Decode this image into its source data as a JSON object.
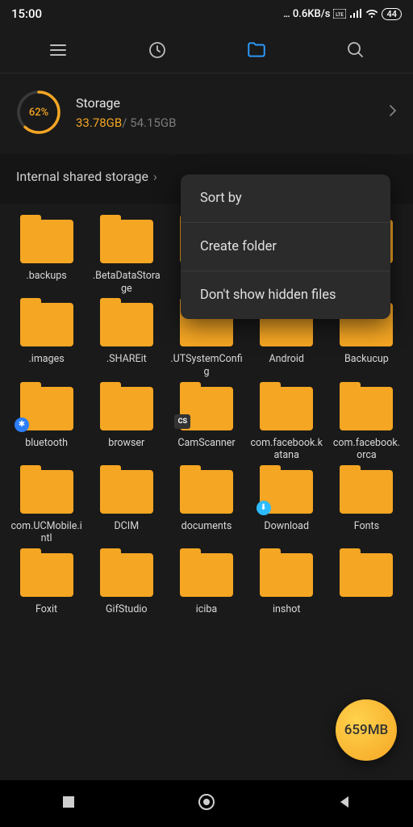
{
  "status": {
    "time": "15:00",
    "net_speed": "0.6KB/s",
    "battery": "44"
  },
  "storage": {
    "title": "Storage",
    "percent": "62%",
    "used": "33.78GB",
    "total": "54.15GB"
  },
  "breadcrumb": {
    "path": "Internal shared storage"
  },
  "popup": {
    "sort": "Sort by",
    "create": "Create folder",
    "hidden": "Don't show hidden files"
  },
  "fab": {
    "label": "659MB"
  },
  "folders": {
    "r1": [
      ".backups",
      ".BetaDataStorage",
      ".",
      "",
      ""
    ],
    "r2": [
      ".images",
      ".SHAREit",
      ".UTSystemConfig",
      "Android",
      "Backucup"
    ],
    "r3": [
      "bluetooth",
      "browser",
      "CamScanner",
      "com.facebook.katana",
      "com.facebook.orca"
    ],
    "r4": [
      "com.UCMobile.intl",
      "DCIM",
      "documents",
      "Download",
      "Fonts"
    ],
    "r5": [
      "Foxit",
      "GifStudio",
      "iciba",
      "inshot",
      ""
    ]
  }
}
